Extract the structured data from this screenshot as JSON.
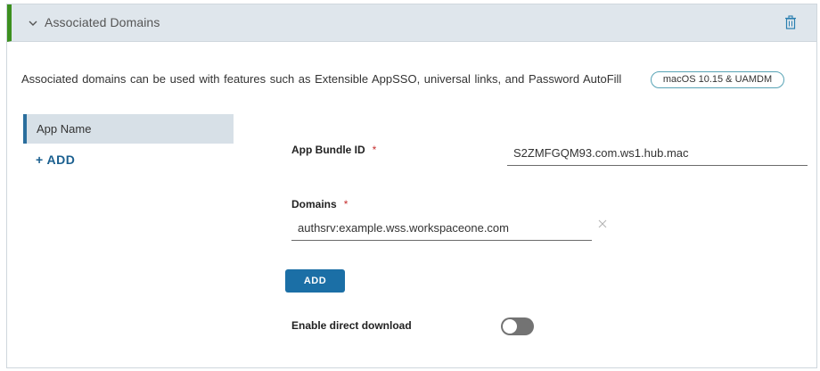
{
  "section": {
    "title": "Associated Domains",
    "collapse_icon": "chevron-down-icon",
    "delete_icon": "trash-icon",
    "accent_color": "#3c8f1f"
  },
  "description": "Associated domains can be used with features such as Extensible AppSSO, universal links, and Password AutoFill",
  "os_badge": "macOS 10.15 & UAMDM",
  "app_list": {
    "items": [
      {
        "label": "App Name"
      }
    ],
    "add_label": "+ ADD"
  },
  "form": {
    "app_bundle_id": {
      "label": "App Bundle ID",
      "required_mark": "*",
      "value": "S2ZMFGQM93.com.ws1.hub.mac"
    },
    "domains": {
      "label": "Domains",
      "required_mark": "*",
      "value": "authsrv:example.wss.workspaceone.com",
      "clear_icon": "close-icon"
    },
    "add_button_label": "ADD",
    "direct_download": {
      "label": "Enable direct download",
      "enabled": false
    }
  }
}
